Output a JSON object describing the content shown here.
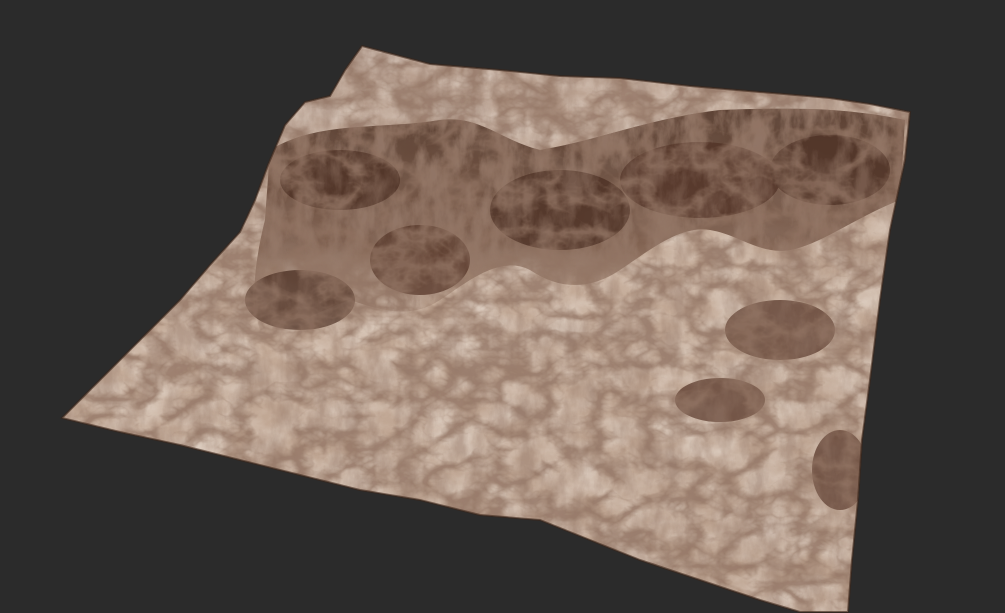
{
  "scene": {
    "background_color": "#2b2b2b",
    "subject": "terrain-heightmap-render",
    "colors": {
      "sand_light": "#cdb6a2",
      "sand_mid": "#b89d86",
      "rock_dark": "#5a3a2c",
      "rock_deep": "#3a2419",
      "highlight": "#e6d6c6"
    }
  }
}
